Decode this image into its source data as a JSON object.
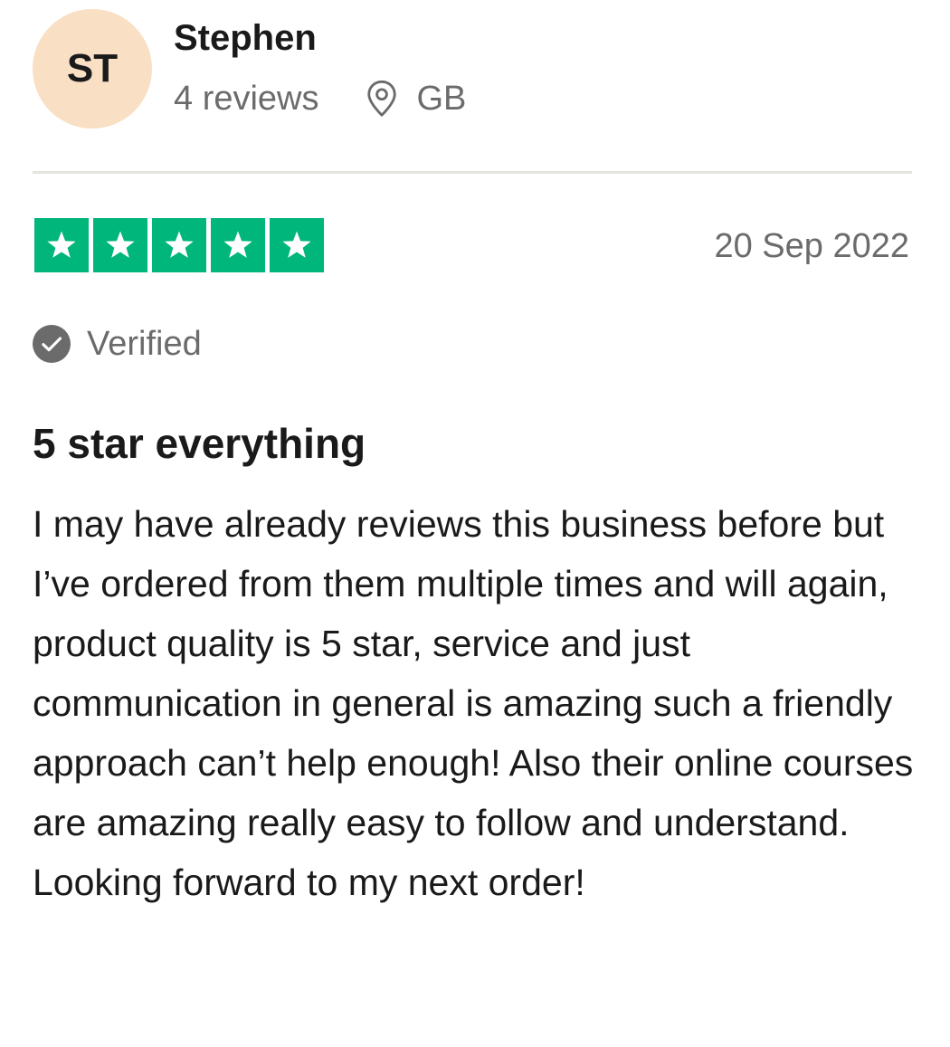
{
  "reviewer": {
    "initials": "ST",
    "name": "Stephen",
    "review_count": "4 reviews",
    "location": "GB",
    "avatar_color": "#f9dfc3"
  },
  "review": {
    "rating": 5,
    "max_rating": 5,
    "star_color": "#00b67a",
    "date": "20 Sep 2022",
    "verified_label": "Verified",
    "title": "5 star everything",
    "body": "I may have already reviews this business before but I’ve ordered from them multiple times and will again, product quality is 5 star, service and just communication in general is amazing such a friendly approach can’t help enough! Also their online courses are amazing really easy to follow and understand. Looking forward to my next order!"
  },
  "icons": {
    "location": "location-pin-icon",
    "verified": "check-circle-icon",
    "star": "star-icon"
  }
}
